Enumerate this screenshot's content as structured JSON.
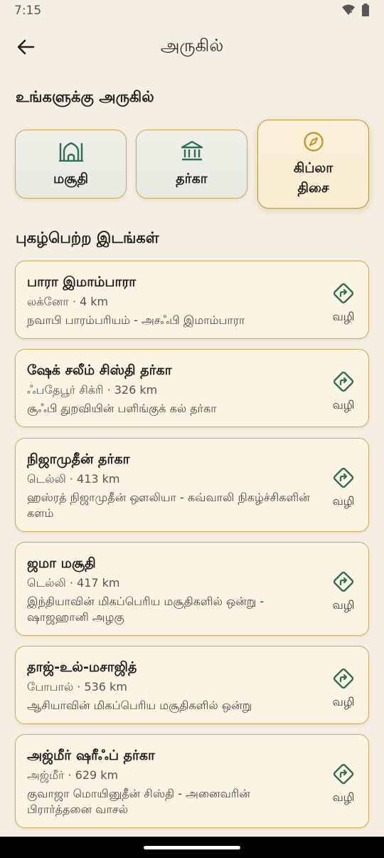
{
  "status_bar": {
    "time": "7:15"
  },
  "header": {
    "title": "அருகில்"
  },
  "nearby": {
    "heading": "உங்களுக்கு அருகில்",
    "categories": [
      {
        "label": "மசூதி",
        "icon": "mosque-icon",
        "selected": false
      },
      {
        "label": "தர்கா",
        "icon": "dargah-icon",
        "selected": false
      },
      {
        "label_line1": "கிப்லா",
        "label_line2": "திசை",
        "icon": "compass-icon",
        "selected": true
      }
    ]
  },
  "famous": {
    "heading": "புகழ்பெற்ற இடங்கள்",
    "route_label": "வழி",
    "places": [
      {
        "name": "பாரா இமாம்பாரா",
        "meta": "லக்னோ · 4 km",
        "desc": "நவாபி பாரம்பரியம் - அசஃபி இமாம்பாரா"
      },
      {
        "name": "ஷேக் சலீம் சிஸ்தி தர்கா",
        "meta": "ஃபதேபூர் சிக்ரி · 326 km",
        "desc": "சூஃபி துறவியின் பளிங்குக் கல் தர்கா"
      },
      {
        "name": "நிஜாமுதீன் தர்கா",
        "meta": "டெல்லி · 413 km",
        "desc": "ஹஸ்ரத் நிஜாமுதீன் ஔலியா - கவ்வாலி நிகழ்ச்சிகளின் களம்"
      },
      {
        "name": "ஜமா மசூதி",
        "meta": "டெல்லி · 417 km",
        "desc": "இந்தியாவின் மிகப்பெரிய மசூதிகளில் ஒன்று - ஷாஜஹானி அழகு"
      },
      {
        "name": "தாஜ்-உல்-மசாஜித்",
        "meta": "போபால் · 536 km",
        "desc": "ஆசியாவின் மிகப்பெரிய மசூதிகளில் ஒன்று"
      },
      {
        "name": "அஜ்மீர் ஷரீஃப் தர்கா",
        "meta": "அஜ்மீர் · 629 km",
        "desc": "குவாஜா மொயினுதீன் சிஸ்தி - அனைவரின் பிரார்த்தனை வாசல்"
      }
    ]
  },
  "colors": {
    "accent_green": "#2f6e55",
    "accent_gold": "#c49a2c",
    "border_gold": "#c9a85c",
    "background": "#f5efe3"
  }
}
